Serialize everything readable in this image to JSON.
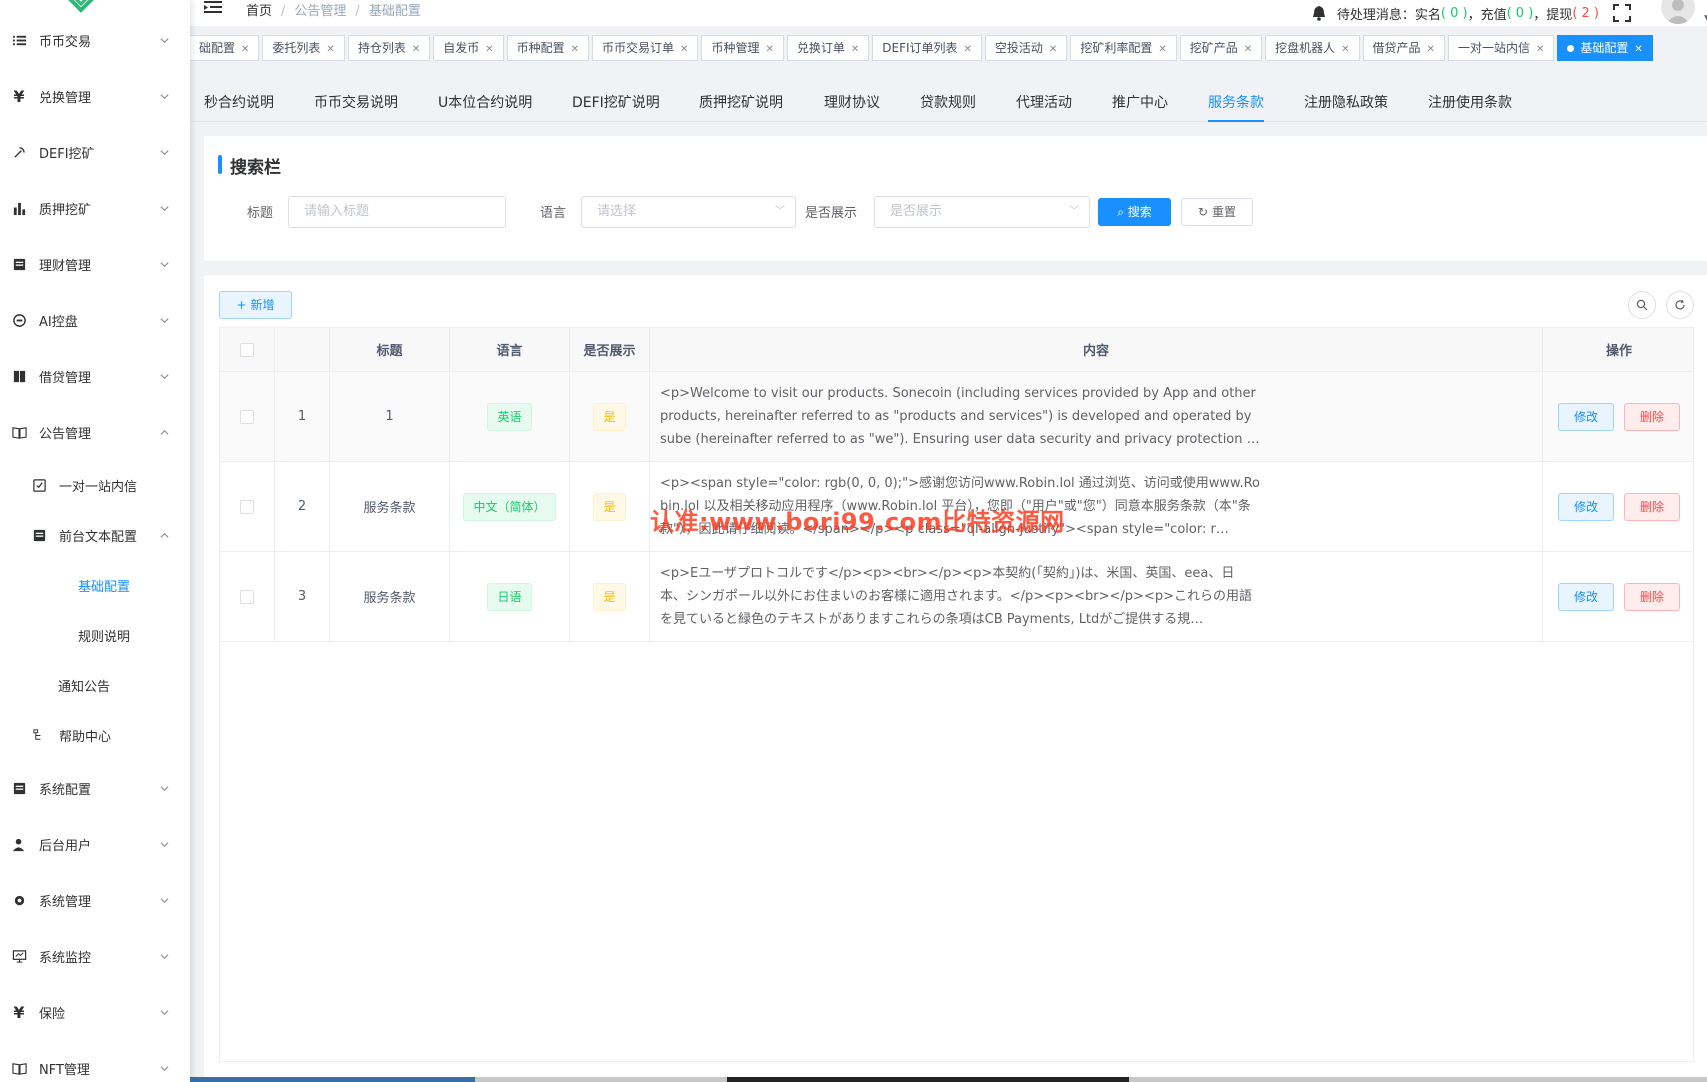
{
  "sidebar": {
    "items": [
      {
        "label": "币币交易",
        "icon": "list-icon"
      },
      {
        "label": "兑换管理",
        "icon": "yen-icon"
      },
      {
        "label": "DEFI挖矿",
        "icon": "mining-icon"
      },
      {
        "label": "质押挖矿",
        "icon": "bar-chart-icon"
      },
      {
        "label": "理财管理",
        "icon": "document-icon"
      },
      {
        "label": "AI控盘",
        "icon": "robot-icon"
      },
      {
        "label": "借贷管理",
        "icon": "book-icon"
      },
      {
        "label": "公告管理",
        "icon": "open-book-icon"
      },
      {
        "label": "一对一站内信",
        "icon": "checkbox-icon"
      },
      {
        "label": "前台文本配置",
        "icon": "document-icon"
      },
      {
        "label": "基础配置",
        "icon": ""
      },
      {
        "label": "规则说明",
        "icon": ""
      },
      {
        "label": "通知公告",
        "icon": ""
      },
      {
        "label": "帮助中心",
        "icon": "tree-icon"
      },
      {
        "label": "系统配置",
        "icon": "document-icon"
      },
      {
        "label": "后台用户",
        "icon": "user-icon"
      },
      {
        "label": "系统管理",
        "icon": "gear-icon"
      },
      {
        "label": "系统监控",
        "icon": "monitor-icon"
      },
      {
        "label": "保险",
        "icon": "yen-icon"
      },
      {
        "label": "NFT管理",
        "icon": "book-icon"
      }
    ]
  },
  "topbar": {
    "breadcrumb": [
      "首页",
      "公告管理",
      "基础配置"
    ],
    "pending_label": "待处理消息：",
    "realname_label": "实名",
    "realname_count": "( 0 )",
    "recharge_label": "充值",
    "recharge_count": "( 0 )",
    "withdraw_label": "提现",
    "withdraw_count": "( 2 )"
  },
  "tags": [
    "础配置",
    "委托列表",
    "持仓列表",
    "自发币",
    "币种配置",
    "币币交易订单",
    "币种管理",
    "兑换订单",
    "DEFI订单列表",
    "空投活动",
    "挖矿利率配置",
    "挖矿产品",
    "挖盘机器人",
    "借贷产品",
    "一对一站内信",
    "基础配置"
  ],
  "subtabs": [
    "秒合约说明",
    "币币交易说明",
    "U本位合约说明",
    "DEFI挖矿说明",
    "质押挖矿说明",
    "理财协议",
    "贷款规则",
    "代理活动",
    "推广中心",
    "服务条款",
    "注册隐私政策",
    "注册使用条款"
  ],
  "search": {
    "title": "搜索栏",
    "title_label": "标题",
    "title_placeholder": "请输入标题",
    "lang_label": "语言",
    "lang_placeholder": "请选择",
    "show_label": "是否展示",
    "show_placeholder": "是否展示",
    "search_btn": "搜索",
    "reset_btn": "重置"
  },
  "table": {
    "add_btn": "新增",
    "headers": {
      "title": "标题",
      "lang": "语言",
      "show": "是否展示",
      "content": "内容",
      "ops": "操作"
    },
    "rows": [
      {
        "index": "1",
        "title": "1",
        "lang": "英语",
        "show": "是",
        "content": "<p>Welcome to visit our products. Sonecoin (including services provided by App and other products, hereinafter referred to as \"products and services\") is developed and operated by sube (hereinafter referred to as \"we\"). Ensuring user data security and privacy protection is our top pri…"
      },
      {
        "index": "2",
        "title": "服务条款",
        "lang": "中文（简体）",
        "show": "是",
        "content": " <p><span style=\"color: rgb(0, 0, 0);\">感谢您访问www.Robin.lol 通过浏览、访问或使用www.Robin.lol 以及相关移动应用程序（www.Robin.lol 平台），您即（\"用户\"或\"您\"）同意本服务条款（本\"条款\"），因此请仔细阅读。</span></p><p class=\"ql-align-justify\"><span style=\"color: r…"
      },
      {
        "index": "3",
        "title": "服务条款",
        "lang": "日语",
        "show": "是",
        "content": " <p>Eユーザプロトコルです</p><p><br></p><p>本契約(「契約」)は、米国、英国、eea、日本、シンガポール以外にお住まいのお客様に適用されます。</p><p><br></p><p>これらの用語を見ていると緑色のテキストがありますこれらの条項はCB Payments, Ltdがご提供する規…"
      }
    ],
    "edit_btn": "修改",
    "delete_btn": "删除"
  },
  "watermark": "认准:www.bori99.com比特资源网",
  "colors": {
    "primary": "#1890ff",
    "success": "#13ce66",
    "danger": "#ff4949",
    "warning": "#ffba00"
  }
}
